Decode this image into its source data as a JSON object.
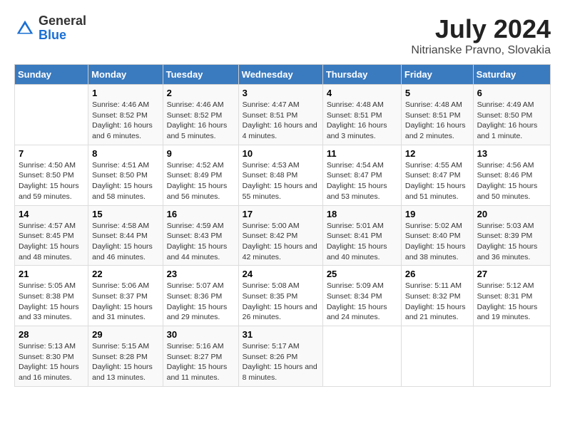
{
  "header": {
    "logo_general": "General",
    "logo_blue": "Blue",
    "title": "July 2024",
    "subtitle": "Nitrianske Pravno, Slovakia"
  },
  "calendar": {
    "days_of_week": [
      "Sunday",
      "Monday",
      "Tuesday",
      "Wednesday",
      "Thursday",
      "Friday",
      "Saturday"
    ],
    "weeks": [
      [
        {
          "day": "",
          "sunrise": "",
          "sunset": "",
          "daylight": ""
        },
        {
          "day": "1",
          "sunrise": "Sunrise: 4:46 AM",
          "sunset": "Sunset: 8:52 PM",
          "daylight": "Daylight: 16 hours and 6 minutes."
        },
        {
          "day": "2",
          "sunrise": "Sunrise: 4:46 AM",
          "sunset": "Sunset: 8:52 PM",
          "daylight": "Daylight: 16 hours and 5 minutes."
        },
        {
          "day": "3",
          "sunrise": "Sunrise: 4:47 AM",
          "sunset": "Sunset: 8:51 PM",
          "daylight": "Daylight: 16 hours and 4 minutes."
        },
        {
          "day": "4",
          "sunrise": "Sunrise: 4:48 AM",
          "sunset": "Sunset: 8:51 PM",
          "daylight": "Daylight: 16 hours and 3 minutes."
        },
        {
          "day": "5",
          "sunrise": "Sunrise: 4:48 AM",
          "sunset": "Sunset: 8:51 PM",
          "daylight": "Daylight: 16 hours and 2 minutes."
        },
        {
          "day": "6",
          "sunrise": "Sunrise: 4:49 AM",
          "sunset": "Sunset: 8:50 PM",
          "daylight": "Daylight: 16 hours and 1 minute."
        }
      ],
      [
        {
          "day": "7",
          "sunrise": "Sunrise: 4:50 AM",
          "sunset": "Sunset: 8:50 PM",
          "daylight": "Daylight: 15 hours and 59 minutes."
        },
        {
          "day": "8",
          "sunrise": "Sunrise: 4:51 AM",
          "sunset": "Sunset: 8:50 PM",
          "daylight": "Daylight: 15 hours and 58 minutes."
        },
        {
          "day": "9",
          "sunrise": "Sunrise: 4:52 AM",
          "sunset": "Sunset: 8:49 PM",
          "daylight": "Daylight: 15 hours and 56 minutes."
        },
        {
          "day": "10",
          "sunrise": "Sunrise: 4:53 AM",
          "sunset": "Sunset: 8:48 PM",
          "daylight": "Daylight: 15 hours and 55 minutes."
        },
        {
          "day": "11",
          "sunrise": "Sunrise: 4:54 AM",
          "sunset": "Sunset: 8:47 PM",
          "daylight": "Daylight: 15 hours and 53 minutes."
        },
        {
          "day": "12",
          "sunrise": "Sunrise: 4:55 AM",
          "sunset": "Sunset: 8:47 PM",
          "daylight": "Daylight: 15 hours and 51 minutes."
        },
        {
          "day": "13",
          "sunrise": "Sunrise: 4:56 AM",
          "sunset": "Sunset: 8:46 PM",
          "daylight": "Daylight: 15 hours and 50 minutes."
        }
      ],
      [
        {
          "day": "14",
          "sunrise": "Sunrise: 4:57 AM",
          "sunset": "Sunset: 8:45 PM",
          "daylight": "Daylight: 15 hours and 48 minutes."
        },
        {
          "day": "15",
          "sunrise": "Sunrise: 4:58 AM",
          "sunset": "Sunset: 8:44 PM",
          "daylight": "Daylight: 15 hours and 46 minutes."
        },
        {
          "day": "16",
          "sunrise": "Sunrise: 4:59 AM",
          "sunset": "Sunset: 8:43 PM",
          "daylight": "Daylight: 15 hours and 44 minutes."
        },
        {
          "day": "17",
          "sunrise": "Sunrise: 5:00 AM",
          "sunset": "Sunset: 8:42 PM",
          "daylight": "Daylight: 15 hours and 42 minutes."
        },
        {
          "day": "18",
          "sunrise": "Sunrise: 5:01 AM",
          "sunset": "Sunset: 8:41 PM",
          "daylight": "Daylight: 15 hours and 40 minutes."
        },
        {
          "day": "19",
          "sunrise": "Sunrise: 5:02 AM",
          "sunset": "Sunset: 8:40 PM",
          "daylight": "Daylight: 15 hours and 38 minutes."
        },
        {
          "day": "20",
          "sunrise": "Sunrise: 5:03 AM",
          "sunset": "Sunset: 8:39 PM",
          "daylight": "Daylight: 15 hours and 36 minutes."
        }
      ],
      [
        {
          "day": "21",
          "sunrise": "Sunrise: 5:05 AM",
          "sunset": "Sunset: 8:38 PM",
          "daylight": "Daylight: 15 hours and 33 minutes."
        },
        {
          "day": "22",
          "sunrise": "Sunrise: 5:06 AM",
          "sunset": "Sunset: 8:37 PM",
          "daylight": "Daylight: 15 hours and 31 minutes."
        },
        {
          "day": "23",
          "sunrise": "Sunrise: 5:07 AM",
          "sunset": "Sunset: 8:36 PM",
          "daylight": "Daylight: 15 hours and 29 minutes."
        },
        {
          "day": "24",
          "sunrise": "Sunrise: 5:08 AM",
          "sunset": "Sunset: 8:35 PM",
          "daylight": "Daylight: 15 hours and 26 minutes."
        },
        {
          "day": "25",
          "sunrise": "Sunrise: 5:09 AM",
          "sunset": "Sunset: 8:34 PM",
          "daylight": "Daylight: 15 hours and 24 minutes."
        },
        {
          "day": "26",
          "sunrise": "Sunrise: 5:11 AM",
          "sunset": "Sunset: 8:32 PM",
          "daylight": "Daylight: 15 hours and 21 minutes."
        },
        {
          "day": "27",
          "sunrise": "Sunrise: 5:12 AM",
          "sunset": "Sunset: 8:31 PM",
          "daylight": "Daylight: 15 hours and 19 minutes."
        }
      ],
      [
        {
          "day": "28",
          "sunrise": "Sunrise: 5:13 AM",
          "sunset": "Sunset: 8:30 PM",
          "daylight": "Daylight: 15 hours and 16 minutes."
        },
        {
          "day": "29",
          "sunrise": "Sunrise: 5:15 AM",
          "sunset": "Sunset: 8:28 PM",
          "daylight": "Daylight: 15 hours and 13 minutes."
        },
        {
          "day": "30",
          "sunrise": "Sunrise: 5:16 AM",
          "sunset": "Sunset: 8:27 PM",
          "daylight": "Daylight: 15 hours and 11 minutes."
        },
        {
          "day": "31",
          "sunrise": "Sunrise: 5:17 AM",
          "sunset": "Sunset: 8:26 PM",
          "daylight": "Daylight: 15 hours and 8 minutes."
        },
        {
          "day": "",
          "sunrise": "",
          "sunset": "",
          "daylight": ""
        },
        {
          "day": "",
          "sunrise": "",
          "sunset": "",
          "daylight": ""
        },
        {
          "day": "",
          "sunrise": "",
          "sunset": "",
          "daylight": ""
        }
      ]
    ]
  }
}
